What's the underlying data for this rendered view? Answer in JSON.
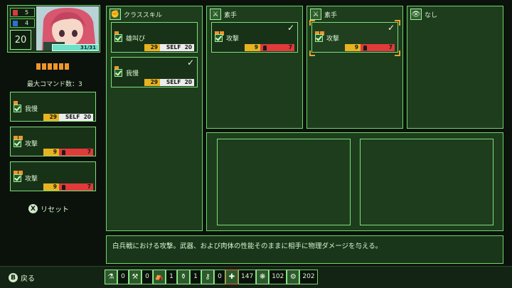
{
  "character": {
    "hp_current_max": "31/31",
    "level": "20",
    "stat_red": "5",
    "stat_blue": "4"
  },
  "max_commands_label": "最大コマンド数：3",
  "left_commands": [
    {
      "name": "我慢",
      "cost": "29",
      "target": "SELF",
      "value": "20",
      "pips": 1
    },
    {
      "name": "攻撃",
      "cost": "9",
      "value": "7",
      "pips": 2
    },
    {
      "name": "攻撃",
      "cost": "9",
      "value": "7",
      "pips": 2
    }
  ],
  "reset_label": "リセット",
  "reset_button_glyph": "X",
  "class_skill": {
    "title": "クラススキル",
    "skills": [
      {
        "name": "雄叫び",
        "cost": "29",
        "target": "SELF",
        "value": "20"
      },
      {
        "name": "我慢",
        "cost": "29",
        "target": "SELF",
        "value": "20"
      }
    ]
  },
  "weapon_slots": [
    {
      "title": "素手",
      "skill": {
        "name": "攻撃",
        "cost": "9",
        "value": "7"
      }
    },
    {
      "title": "素手",
      "skill": {
        "name": "攻撃",
        "cost": "9",
        "value": "7"
      }
    }
  ],
  "accessory_slot": {
    "title": "なし"
  },
  "description": "白兵戦における攻撃。武器、および肉体の性能そのままに相手に物理ダメージを与える。",
  "back_label": "戻る",
  "back_button_glyph": "B",
  "inventory": [
    "0",
    "0",
    "1",
    "1",
    "0",
    "147",
    "102",
    "202"
  ],
  "colors": {
    "accent": "#6fd66a",
    "cost": "#e8b320",
    "damage": "#e03a3a",
    "pip": "#f0962a"
  }
}
